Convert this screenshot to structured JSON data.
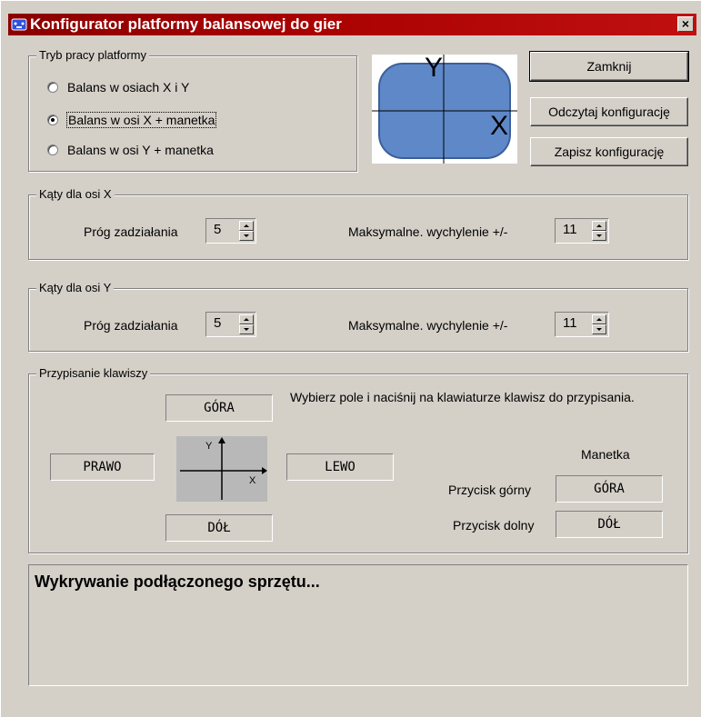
{
  "window": {
    "title": "Konfigurator platformy balansowej do gier",
    "close_label": "×",
    "title_bg": "#a80000"
  },
  "mode_group": {
    "title": "Tryb pracy platformy",
    "options": [
      {
        "label": "Balans  w osiach  X i Y",
        "checked": false
      },
      {
        "label": "Balans w osi X  +  manetka",
        "checked": true
      },
      {
        "label": "Balans w osi  Y  +  manetka",
        "checked": false
      }
    ]
  },
  "platform_image": {
    "y_label": "Y",
    "x_label": "X",
    "fill_color": "#5f88c8"
  },
  "buttons": {
    "close": "Zamknij",
    "read_config": "Odczytaj konfigurację",
    "save_config": "Zapisz konfigurację"
  },
  "angles_x": {
    "title": "Kąty dla osi X",
    "threshold_label": "Próg zadziałania",
    "threshold_value": "5",
    "max_label": "Maksymalne. wychylenie +/-",
    "max_value": "11"
  },
  "angles_y": {
    "title": "Kąty dla osi Y",
    "threshold_label": "Próg zadziałania",
    "threshold_value": "5",
    "max_label": "Maksymalne. wychylenie +/-",
    "max_value": "11"
  },
  "keys_group": {
    "title": "Przypisanie klawiszy",
    "instruction": "Wybierz pole i naciśnij na klawiaturze klawisz do przypisania.",
    "up": "GÓRA",
    "right": "PRAWO",
    "left": "LEWO",
    "down": "DÓŁ",
    "diagram_y": "Y",
    "diagram_x": "X",
    "joystick_title": "Manetka",
    "joystick_upper_label": "Przycisk górny",
    "joystick_upper_value": "GÓRA",
    "joystick_lower_label": "Przycisk dolny",
    "joystick_lower_value": "DÓŁ"
  },
  "status": {
    "text": "Wykrywanie podłączonego sprzętu..."
  }
}
